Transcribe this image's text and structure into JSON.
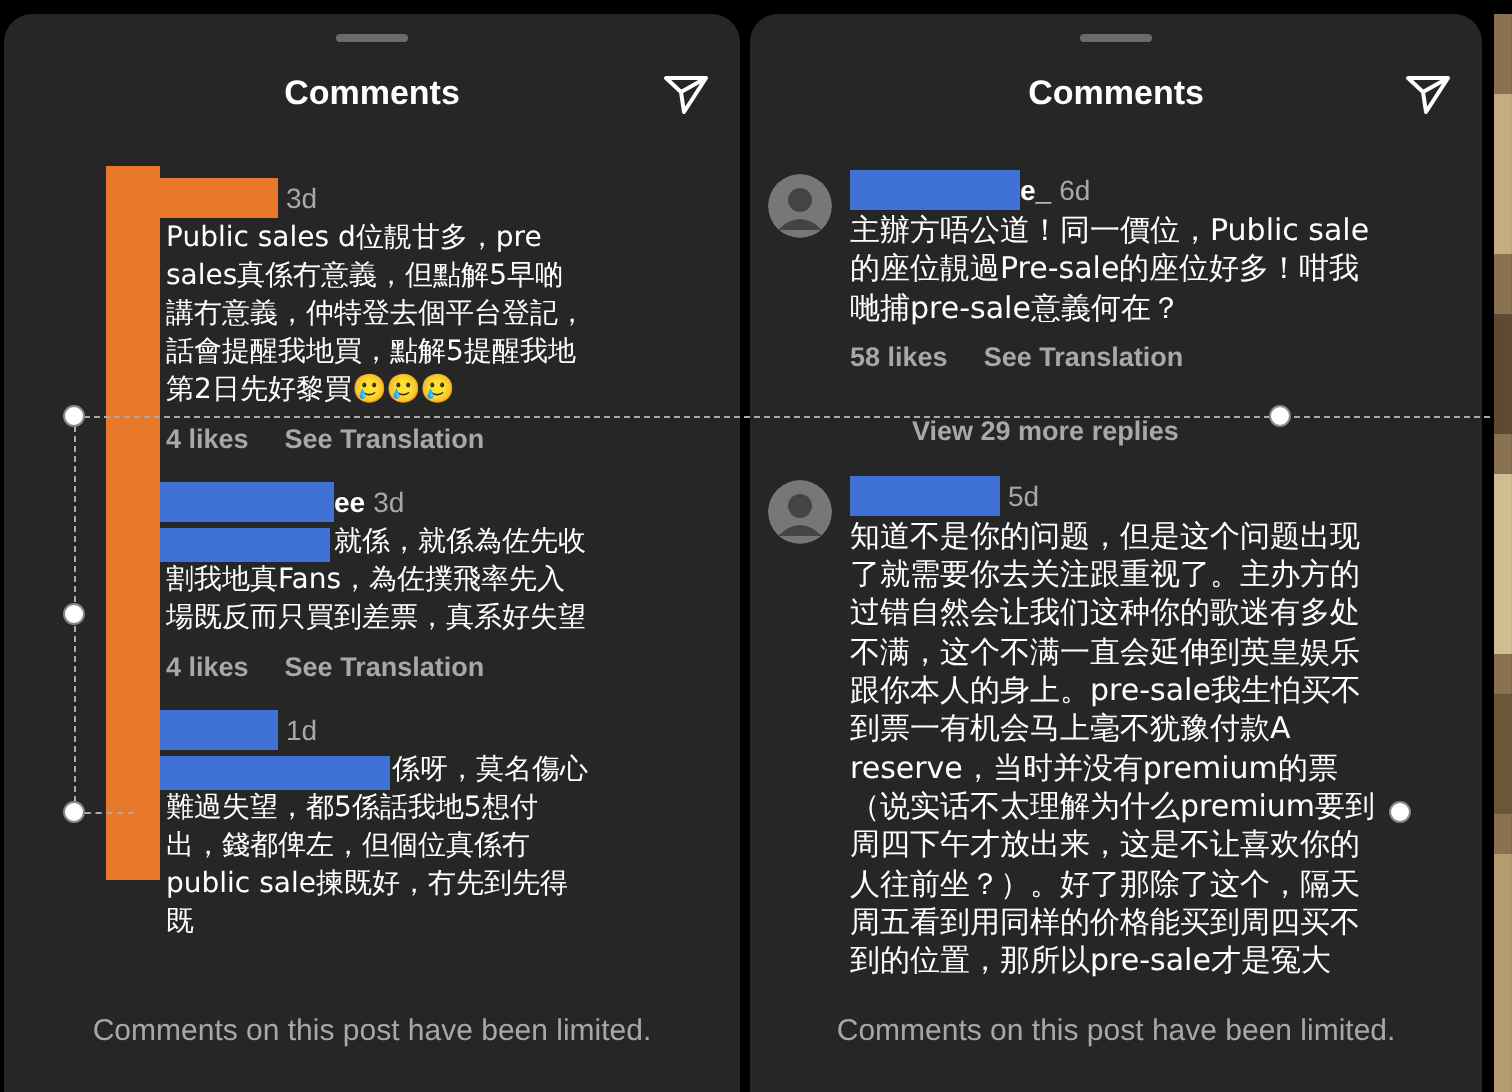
{
  "panels": [
    {
      "title": "Comments",
      "comments": [
        {
          "kind": "reply",
          "color": "#e8792b",
          "time": "3d",
          "text": "Public sales d位靚甘多，pre sales真係冇意義，但點解5早啲講冇意義，仲特登去個平台登記，話會提醒我地買，點解5提醒我地第2日先好黎買🥲🥲🥲",
          "likes": "4 likes",
          "translate": "See Translation"
        },
        {
          "kind": "reply",
          "color": "#3f72d4",
          "name": "ee",
          "time": "3d",
          "text_mask": true,
          "text": "就係，就係為佐先收割我地真Fans，為佐撲飛率先入場既反而只買到差票，真系好失望",
          "likes": "4 likes",
          "translate": "See Translation"
        },
        {
          "kind": "reply",
          "color": "#3f72d4",
          "time": "1d",
          "text_mask": true,
          "text": "係呀，莫名傷心難過失望，都5係話我地5想付出，錢都俾左，但個位真係冇public sale揀既好，冇先到先得既"
        }
      ],
      "footer": "Comments on this post have been limited."
    },
    {
      "title": "Comments",
      "comments": [
        {
          "kind": "comment",
          "color": "#3f72d4",
          "name": "e_",
          "time": "6d",
          "text": "主辦方唔公道！同一價位，Public sale的座位靚過Pre-sale的座位好多！咁我哋捕pre-sale意義何在？",
          "likes": "58 likes",
          "translate": "See Translation",
          "more": "View 29 more replies"
        },
        {
          "kind": "comment",
          "color": "#3f72d4",
          "time": "5d",
          "text": "知道不是你的问题，但是这个问题出现了就需要你去关注跟重视了。主办方的过错自然会让我们这种你的歌迷有多处不满，这个不满一直会延伸到英皇娱乐跟你本人的身上。pre-sale我生怕买不到票一有机会马上毫不犹豫付款A reserve，当时并没有premium的票（说实话不太理解为什么premium要到周四下午才放出来，这是不让喜欢你的人往前坐？）。好了那除了这个，隔天周五看到用同样的价格能买到周四买不到的位置，那所以pre-sale才是冤大"
        }
      ],
      "footer": "Comments on this post have been limited."
    }
  ]
}
